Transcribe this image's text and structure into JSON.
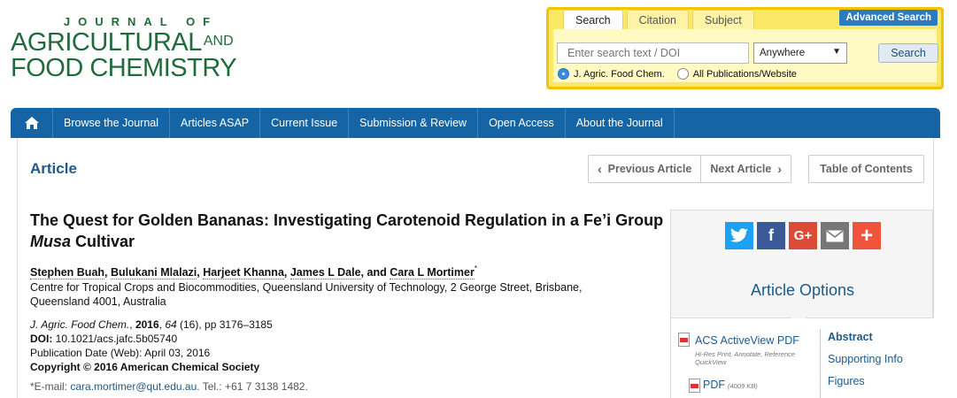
{
  "journal": {
    "top": "JOURNAL OF",
    "line1": "AGRICULTURAL",
    "and": "AND",
    "line2": "FOOD CHEMISTRY"
  },
  "search": {
    "tabs": [
      "Search",
      "Citation",
      "Subject"
    ],
    "active_tab": "Search",
    "advanced_label": "Advanced Search",
    "input_placeholder": "Enter search text / DOI",
    "scope_value": "Anywhere",
    "button_label": "Search",
    "radio_options": [
      {
        "label": "J. Agric. Food Chem.",
        "selected": true
      },
      {
        "label": "All Publications/Website",
        "selected": false
      }
    ]
  },
  "nav": {
    "home_icon": "home-icon",
    "items": [
      "Browse the Journal",
      "Articles ASAP",
      "Current Issue",
      "Submission & Review",
      "Open Access",
      "About the Journal"
    ]
  },
  "article": {
    "label": "Article",
    "prev_label": "Previous Article",
    "next_label": "Next Article",
    "toc_label": "Table of Contents",
    "title_part1": "The Quest for Golden Bananas: Investigating Carotenoid Regulation in a Fe’i Group ",
    "title_italic": "Musa",
    "title_part2": " Cultivar",
    "authors": [
      "Stephen Buah",
      "Bulukani Mlalazi",
      "Harjeet Khanna",
      "James L Dale",
      "Cara L Mortimer"
    ],
    "author_separator": ", ",
    "author_last_separator": ", and ",
    "corresponding_mark": "*",
    "affiliation": "Centre for Tropical Crops and Biocommodities, Queensland University of Technology, 2 George Street, Brisbane, Queensland 4001, Australia",
    "citation": {
      "journal": "J. Agric. Food Chem.",
      "year": "2016",
      "volume": "64",
      "issue_pages": " (16), pp 3176–3185"
    },
    "doi_label": "DOI:",
    "doi": " 10.1021/acs.jafc.5b05740",
    "pub_date": "Publication Date (Web): April 03, 2016",
    "copyright": "Copyright © 2016 American Chemical Society",
    "email_prefix": "*E-mail: ",
    "email": "cara.mortimer@qut.edu.au",
    "tel": ". Tel.: +61 7 3138 1482."
  },
  "sidebar": {
    "share": [
      {
        "icon": "twitter-icon",
        "color": "#1da1f2"
      },
      {
        "icon": "facebook-icon",
        "color": "#3b5998"
      },
      {
        "icon": "google-plus-icon",
        "color": "#dc4a38"
      },
      {
        "icon": "email-icon",
        "color": "#777777"
      },
      {
        "icon": "plus-icon",
        "color": "#f0543c"
      }
    ],
    "options_title": "Article Options",
    "activeview_label": "ACS ActiveView PDF",
    "activeview_sub": "Hi-Res Print, Annotate, Reference QuickView",
    "pdf_label": "PDF",
    "pdf_size": "(4009 KB)",
    "links": [
      "Abstract",
      "Supporting Info",
      "Figures"
    ]
  }
}
